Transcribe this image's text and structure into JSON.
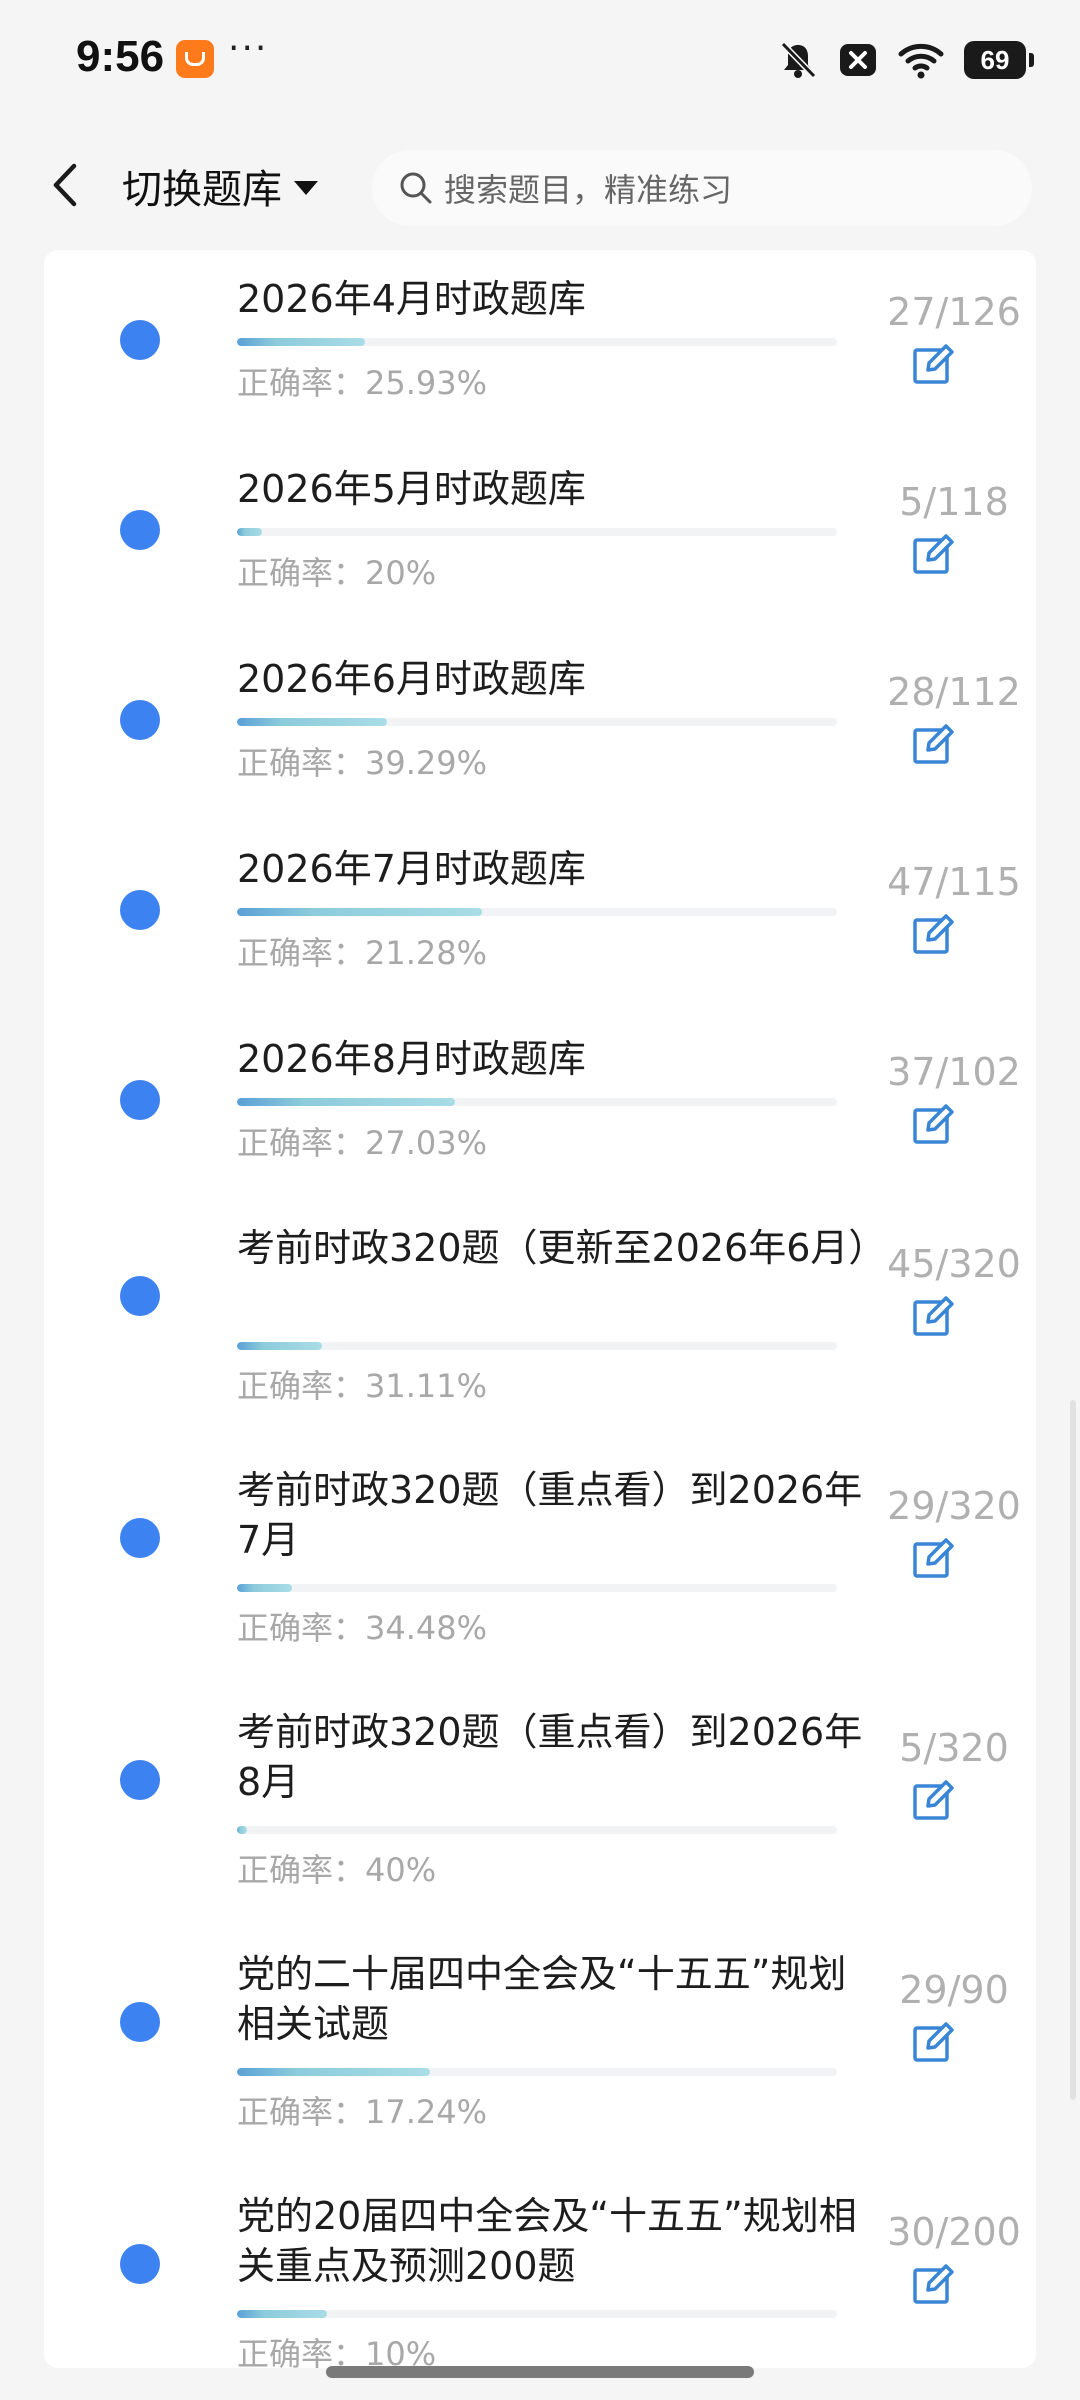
{
  "status_bar": {
    "time": "9:56",
    "dots": "···",
    "battery": "69"
  },
  "nav": {
    "switch_label": "切换题库",
    "search_placeholder": "搜索题目，精准练习"
  },
  "items": [
    {
      "title": "2026年4月时政题库",
      "accuracy": "正确率：25.93%",
      "count": "27/126",
      "progress": 0.214
    },
    {
      "title": "2026年5月时政题库",
      "accuracy": "正确率：20%",
      "count": "5/118",
      "progress": 0.042
    },
    {
      "title": "2026年6月时政题库",
      "accuracy": "正确率：39.29%",
      "count": "28/112",
      "progress": 0.25
    },
    {
      "title": "2026年7月时政题库",
      "accuracy": "正确率：21.28%",
      "count": "47/115",
      "progress": 0.409
    },
    {
      "title": "2026年8月时政题库",
      "accuracy": "正确率：27.03%",
      "count": "37/102",
      "progress": 0.363
    },
    {
      "title": "考前时政320题（更新至2026年6月）",
      "accuracy": "正确率：31.11%",
      "count": "45/320",
      "progress": 0.141
    },
    {
      "title": "考前时政320题（重点看）到2026年7月",
      "accuracy": "正确率：34.48%",
      "count": "29/320",
      "progress": 0.091
    },
    {
      "title": "考前时政320题（重点看）到2026年8月",
      "accuracy": "正确率：40%",
      "count": "5/320",
      "progress": 0.016
    },
    {
      "title": "党的二十届四中全会及“十五五”规划相关试题",
      "accuracy": "正确率：17.24%",
      "count": "29/90",
      "progress": 0.322
    },
    {
      "title": "党的20届四中全会及“十五五”规划相关重点及预测200题",
      "accuracy": "正确率：10%",
      "count": "30/200",
      "progress": 0.15
    }
  ],
  "colors": {
    "dot": "#3c82f0",
    "icon": "#3a86d6",
    "progress": "#8ccbdc"
  }
}
